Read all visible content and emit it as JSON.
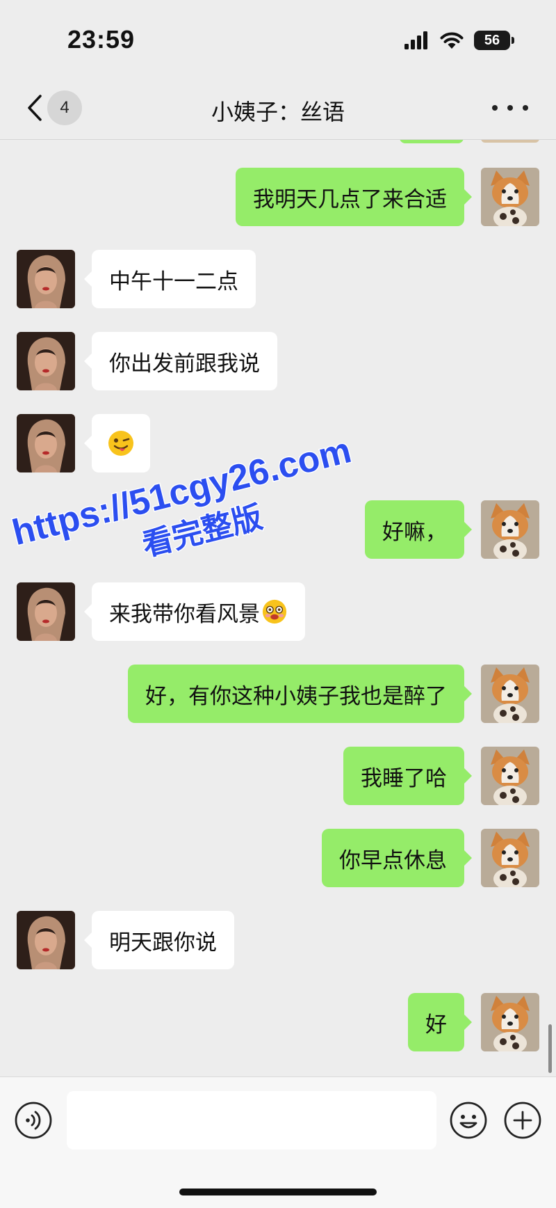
{
  "status_bar": {
    "time": "23:59",
    "battery": "56",
    "signal_icon": "cellular-signal-icon",
    "wifi_icon": "wifi-icon"
  },
  "nav": {
    "back_icon": "chevron-left-icon",
    "unread_count": "4",
    "title": "小姨子：丝语",
    "more_icon": "ellipsis-icon"
  },
  "messages": [
    {
      "from": "me",
      "text": "我明天几点了来合适"
    },
    {
      "from": "them",
      "text": "中午十一二点"
    },
    {
      "from": "them",
      "text": "你出发前跟我说"
    },
    {
      "from": "them",
      "text": "",
      "emoji": "wink-tongue-emoji"
    },
    {
      "from": "me",
      "text": "好嘛，"
    },
    {
      "from": "them",
      "text": "来我带你看风景",
      "emoji": "drooling-face-emoji"
    },
    {
      "from": "me",
      "text": "好，有你这种小姨子我也是醉了"
    },
    {
      "from": "me",
      "text": "我睡了哈"
    },
    {
      "from": "me",
      "text": "你早点休息"
    },
    {
      "from": "them",
      "text": "明天跟你说"
    },
    {
      "from": "me",
      "text": "好"
    }
  ],
  "watermark": {
    "line1": "https://51cgy26.com",
    "line2": "看完整版",
    "color": "#2b4ef0"
  },
  "input_bar": {
    "voice_icon": "voice-icon",
    "input_placeholder": "",
    "emoji_icon": "smiley-icon",
    "plus_icon": "plus-circle-icon"
  },
  "colors": {
    "background": "#ededed",
    "my_bubble": "#95ec69",
    "their_bubble": "#ffffff"
  }
}
